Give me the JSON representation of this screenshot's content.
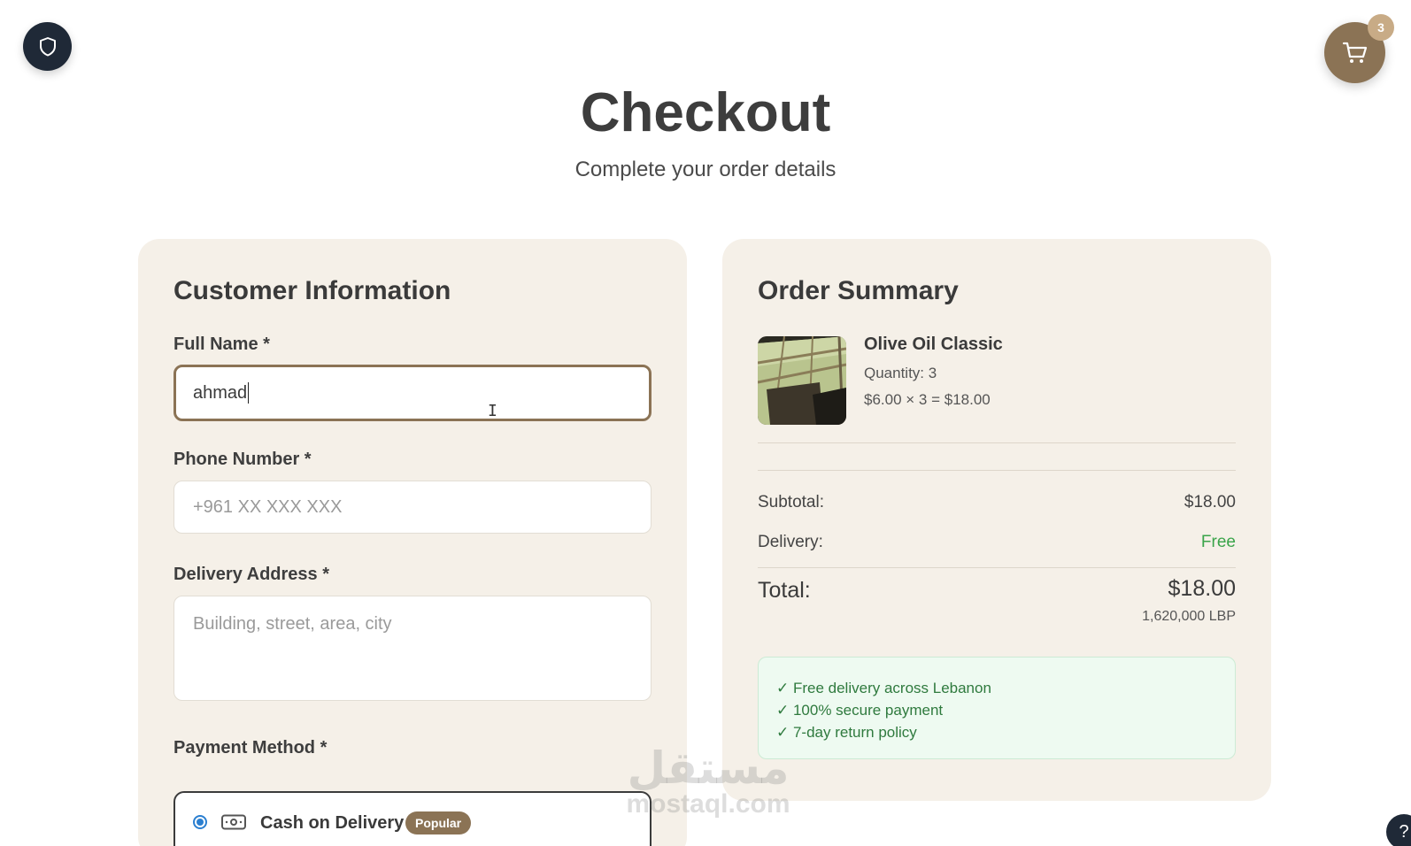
{
  "header": {
    "title": "Checkout",
    "subtitle": "Complete your order details",
    "cart_count": "3",
    "shield_icon": "shield-icon",
    "cart_icon": "cart-icon"
  },
  "customer": {
    "title": "Customer Information",
    "full_name": {
      "label": "Full Name *",
      "value": "ahmad"
    },
    "phone": {
      "label": "Phone Number *",
      "placeholder": "+961 XX XXX XXX"
    },
    "address": {
      "label": "Delivery Address *",
      "placeholder": "Building, street, area, city"
    },
    "payment": {
      "label": "Payment Method *",
      "selected": "Cash on Delivery",
      "badge": "Popular",
      "icon": "cash-icon"
    }
  },
  "summary": {
    "title": "Order Summary",
    "item": {
      "name": "Olive Oil Classic",
      "quantity": "Quantity: 3",
      "price_line": "$6.00 × 3 = $18.00"
    },
    "subtotal_label": "Subtotal:",
    "subtotal_value": "$18.00",
    "delivery_label": "Delivery:",
    "delivery_value": "Free",
    "total_label": "Total:",
    "total_value": "$18.00",
    "total_lbp": "1,620,000 LBP",
    "perks": [
      "✓ Free delivery across Lebanon",
      "✓ 100% secure payment",
      "✓ 7-day return policy"
    ]
  },
  "watermark": {
    "arabic": "مستقل",
    "latin": "mostaql.com"
  },
  "help": {
    "label": "?"
  },
  "colors": {
    "accent": "#8b7355",
    "card_bg": "#f5f0e8",
    "dark": "#1f2937",
    "success": "#3aa44a"
  }
}
